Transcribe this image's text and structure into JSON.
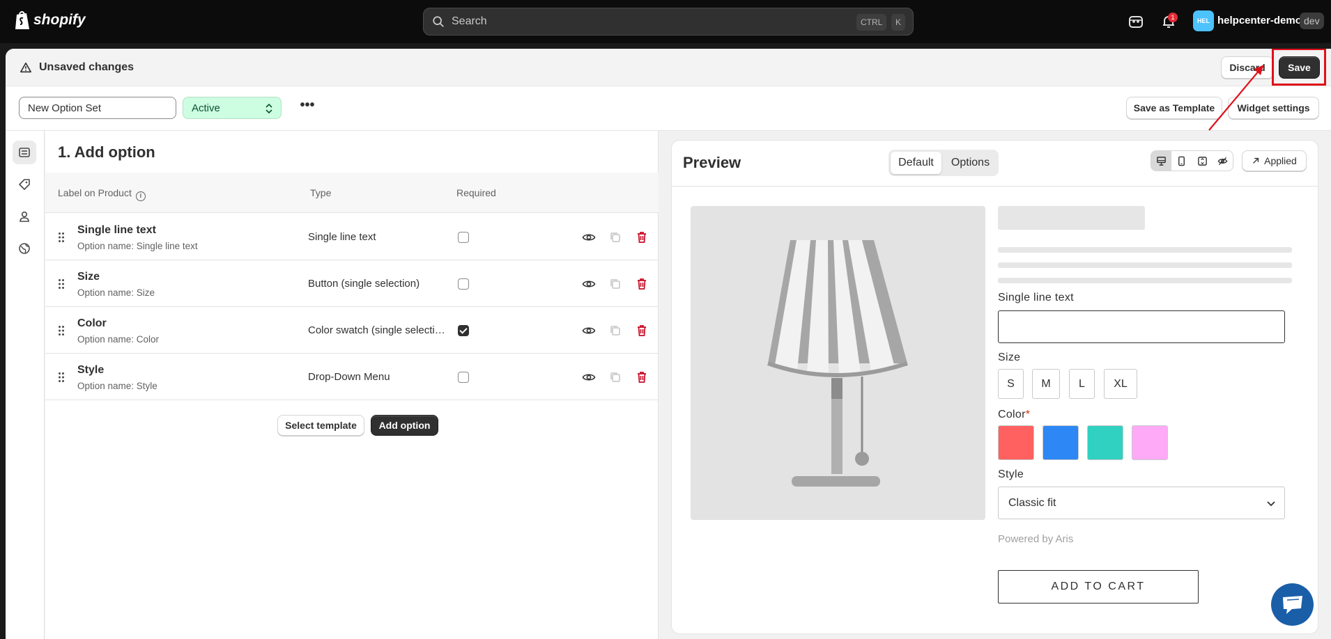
{
  "topbar": {
    "brand": "shopify",
    "search_placeholder": "Search",
    "shortcut_ctrl": "CTRL",
    "shortcut_key": "K",
    "notification_count": "1",
    "avatar_initials": "HEL",
    "store_name": "helpcenter-demo",
    "store_tag": "dev"
  },
  "unsaved_bar": {
    "title": "Unsaved changes",
    "discard_label": "Discard",
    "save_label": "Save"
  },
  "toolbar": {
    "option_set_name": "New Option Set",
    "status": "Active",
    "more_label": "•••",
    "save_template_label": "Save as Template",
    "widget_settings_label": "Widget settings"
  },
  "sidebar": {
    "items": [
      {
        "icon": "options-list-icon",
        "active": true
      },
      {
        "icon": "tag-icon",
        "active": false
      },
      {
        "icon": "person-icon",
        "active": false
      },
      {
        "icon": "globe-icon",
        "active": false
      }
    ]
  },
  "options_panel": {
    "title": "1. Add option",
    "columns": {
      "label": "Label on Product",
      "type": "Type",
      "required": "Required"
    },
    "rows": [
      {
        "label": "Single line text",
        "option_name": "Option name: Single line text",
        "type": "Single line text",
        "required": false
      },
      {
        "label": "Size",
        "option_name": "Option name: Size",
        "type": "Button (single selection)",
        "required": false
      },
      {
        "label": "Color",
        "option_name": "Option name: Color",
        "type": "Color swatch (single selection)",
        "required": true
      },
      {
        "label": "Style",
        "option_name": "Option name: Style",
        "type": "Drop-Down Menu",
        "required": false
      }
    ],
    "select_template_label": "Select template",
    "add_option_label": "Add option"
  },
  "preview": {
    "title": "Preview",
    "tabs": [
      "Default",
      "Options"
    ],
    "active_tab": "Default",
    "applied_label": "Applied",
    "single_line_label": "Single line text",
    "size_label": "Size",
    "sizes": [
      "S",
      "M",
      "L",
      "XL"
    ],
    "color_label": "Color",
    "required_mark": "*",
    "swatches": [
      "#ff6161",
      "#2d87f5",
      "#30d1c0",
      "#ffaaf7"
    ],
    "style_label": "Style",
    "style_value": "Classic fit",
    "powered_by": "Powered by Aris",
    "add_to_cart": "ADD TO CART"
  },
  "colors": {
    "topbar_bg": "#0c0c0c",
    "primary_button": "#303030",
    "status_green": "#cdfee1",
    "delete_red": "#c70a24",
    "highlight_red": "#e0101b",
    "chat_blue": "#1a5ea8"
  }
}
